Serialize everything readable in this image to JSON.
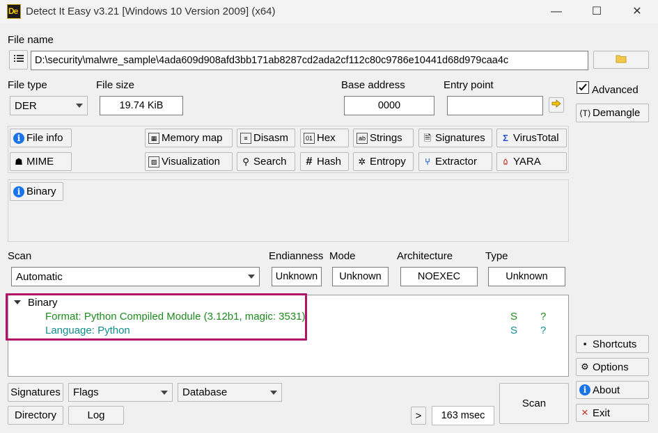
{
  "window": {
    "title": "Detect It Easy v3.21 [Windows 10 Version 2009] (x64)",
    "icon_text": "De",
    "minimize_glyph": "—",
    "maximize_glyph": "☐",
    "close_glyph": "✕"
  },
  "file": {
    "name_label": "File name",
    "path": "D:\\security\\malwre_sample\\4ada609d908afd3bb171ab8287cd2ada2cf112c80c9786e10441d68d979caa4c",
    "type_label": "File type",
    "type_value": "DER",
    "size_label": "File size",
    "size_value": "19.74 KiB",
    "base_label": "Base address",
    "base_value": "0000",
    "entry_label": "Entry point",
    "entry_value": ""
  },
  "right_panel": {
    "advanced_label": "Advanced",
    "advanced_checked": true,
    "demangle_label": "Demangle",
    "shortcuts_label": "Shortcuts",
    "options_label": "Options",
    "about_label": "About",
    "exit_label": "Exit"
  },
  "tools": {
    "file_info": "File info",
    "memory_map": "Memory map",
    "disasm": "Disasm",
    "hex": "Hex",
    "strings": "Strings",
    "signatures": "Signatures",
    "virustotal": "VirusTotal",
    "mime": "MIME",
    "visualization": "Visualization",
    "search": "Search",
    "hash": "Hash",
    "entropy": "Entropy",
    "extractor": "Extractor",
    "yara": "YARA"
  },
  "filetype_tab": {
    "label": "Binary"
  },
  "scan": {
    "label": "Scan",
    "mode_value": "Automatic",
    "endianness_label": "Endianness",
    "endianness_value": "Unknown",
    "mode_label": "Mode",
    "mode_field_value": "Unknown",
    "arch_label": "Architecture",
    "arch_value": "NOEXEC",
    "type_label": "Type",
    "type_value": "Unknown"
  },
  "results": {
    "root": "Binary",
    "rows": [
      {
        "text": "Format: Python Compiled Module (3.12b1, magic: 3531)",
        "s": "S",
        "q": "?"
      },
      {
        "text": "Language: Python",
        "s": "S",
        "q": "?"
      }
    ]
  },
  "bottom": {
    "signatures": "Signatures",
    "flags": "Flags",
    "database": "Database",
    "directory": "Directory",
    "log": "Log",
    "more": ">",
    "time": "163 msec",
    "scan": "Scan"
  },
  "colors": {
    "highlight": "#b3126b",
    "format_text": "#1e8a1e",
    "language_text": "#118c8c"
  }
}
